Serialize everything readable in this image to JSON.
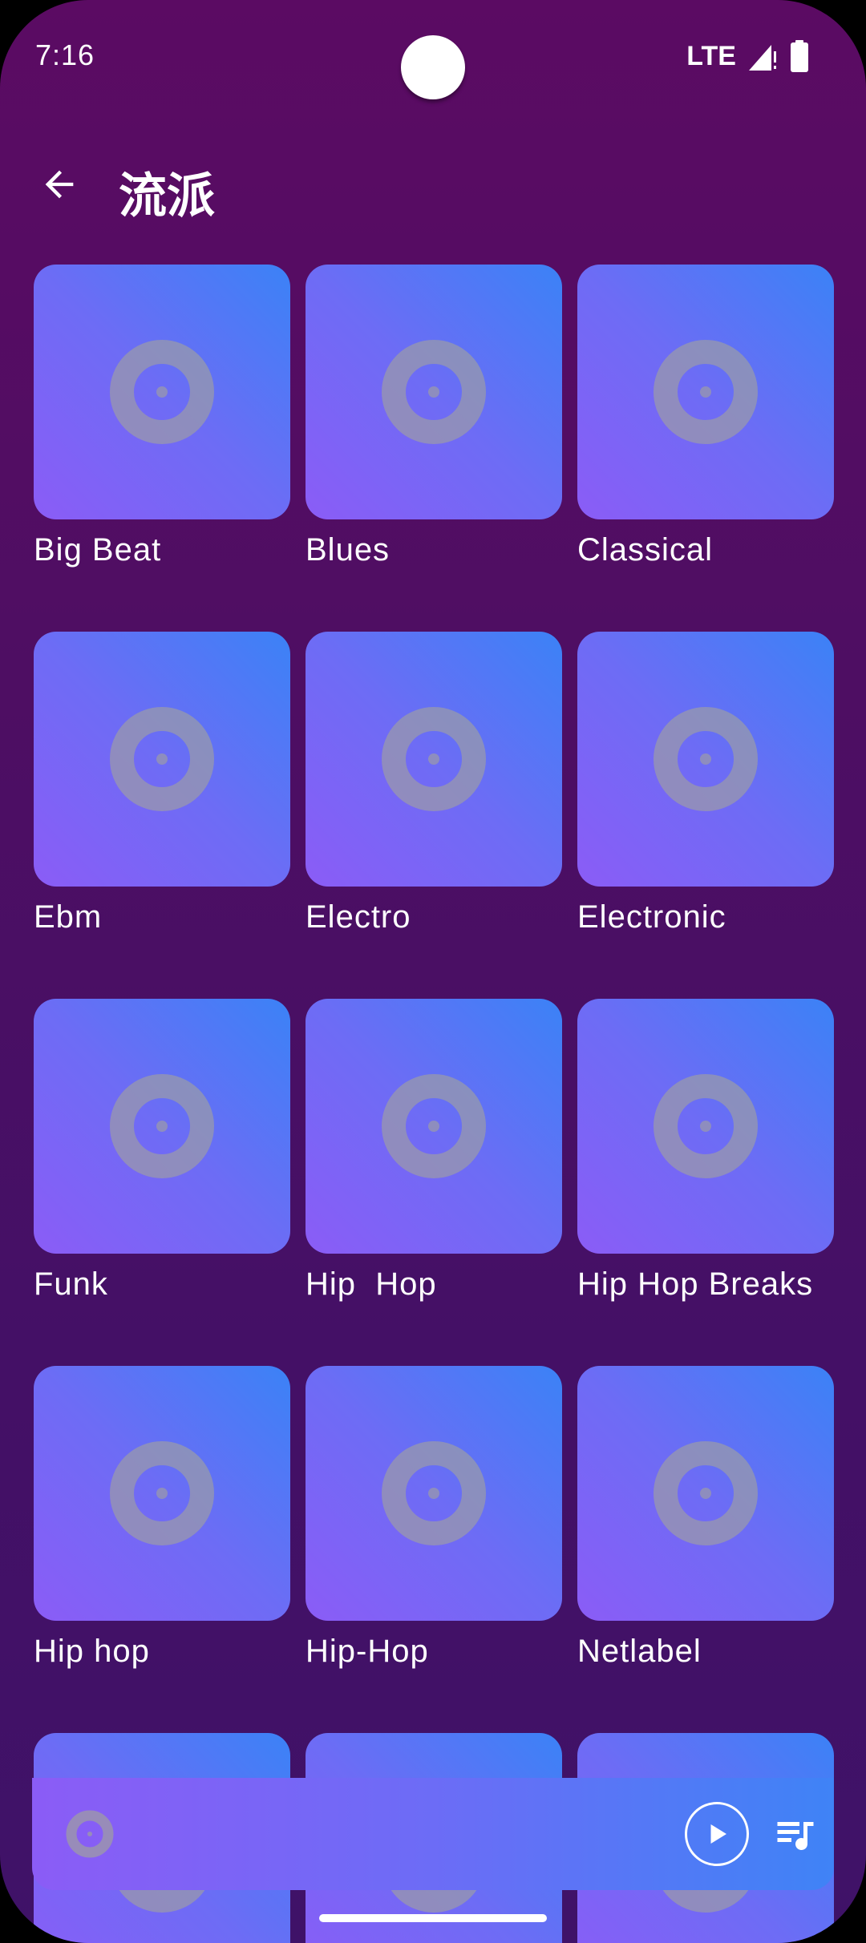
{
  "status_bar": {
    "time": "7:16",
    "network": "LTE",
    "icons": [
      "signal-icon",
      "battery-icon"
    ]
  },
  "header": {
    "back_icon": "arrow-left-icon",
    "title": "流派"
  },
  "genres": [
    "Big Beat",
    "Blues",
    "Classical",
    "Ebm",
    "Electro",
    "Electronic",
    "Funk",
    "Hip  Hop",
    "Hip Hop Breaks",
    "Hip hop",
    "Hip-Hop",
    "Netlabel",
    "",
    "",
    ""
  ],
  "mini_player": {
    "art_icon": "disc-icon",
    "play_icon": "play-icon",
    "queue_icon": "queue-music-icon"
  },
  "colors": {
    "background_top": "#5b0b63",
    "background_bottom": "#3f1268",
    "tile_gradient_start": "#8b5cf6",
    "tile_gradient_end": "#3b82f6",
    "disc_color": "#a0a0a0"
  }
}
